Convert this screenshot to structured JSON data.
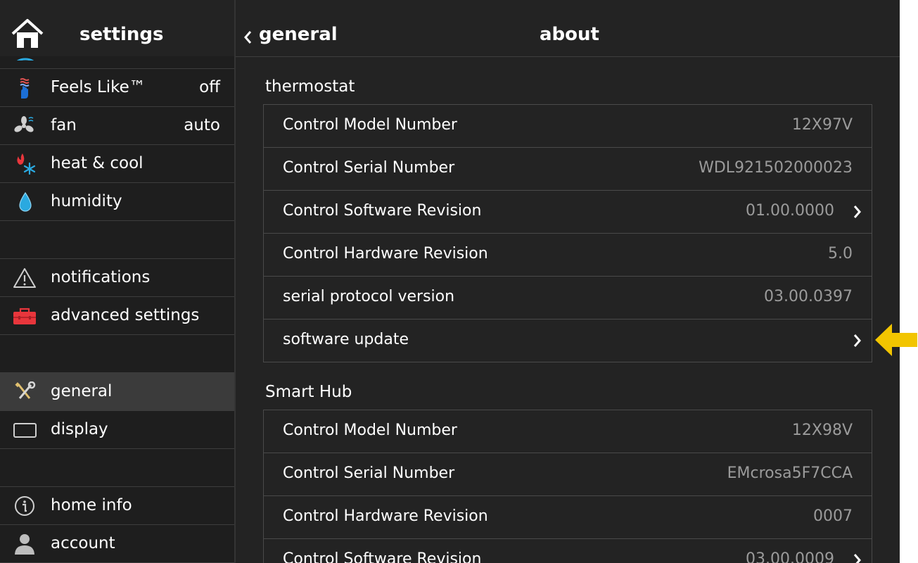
{
  "sidebar": {
    "title": "settings",
    "items": [
      {
        "label": "Feels Like™",
        "value": "off",
        "icon": "hand-waves-icon"
      },
      {
        "label": "fan",
        "value": "auto",
        "icon": "fan-icon"
      },
      {
        "label": "heat & cool",
        "value": "",
        "icon": "flame-snowflake-icon"
      },
      {
        "label": "humidity",
        "value": "",
        "icon": "droplet-icon"
      },
      {
        "label": "notifications",
        "value": "",
        "icon": "warning-triangle-icon"
      },
      {
        "label": "advanced settings",
        "value": "",
        "icon": "toolbox-icon"
      },
      {
        "label": "general",
        "value": "",
        "icon": "wrench-screwdriver-icon",
        "selected": true
      },
      {
        "label": "display",
        "value": "",
        "icon": "display-icon"
      },
      {
        "label": "home info",
        "value": "",
        "icon": "info-icon"
      },
      {
        "label": "account",
        "value": "",
        "icon": "person-icon"
      }
    ]
  },
  "header": {
    "back_label": "general",
    "title": "about"
  },
  "sections": [
    {
      "title": "thermostat",
      "rows": [
        {
          "label": "Control Model Number",
          "value": "12X97V"
        },
        {
          "label": "Control Serial Number",
          "value": "WDL921502000023"
        },
        {
          "label": "Control Software Revision",
          "value": "01.00.0000",
          "link": true
        },
        {
          "label": "Control Hardware Revision",
          "value": "5.0"
        },
        {
          "label": "serial protocol version",
          "value": "03.00.0397"
        },
        {
          "label": "software update",
          "value": "",
          "link": true
        }
      ]
    },
    {
      "title": "Smart Hub",
      "rows": [
        {
          "label": "Control Model Number",
          "value": "12X98V"
        },
        {
          "label": "Control Serial Number",
          "value": "EMcrosa5F7CCA"
        },
        {
          "label": "Control Hardware Revision",
          "value": "0007"
        },
        {
          "label": "Control Software Revision",
          "value": "03.00.0009",
          "link": true
        }
      ]
    }
  ],
  "colors": {
    "background": "#232323",
    "sidebar": "#1e1e1e",
    "selected": "#3b3b3b",
    "value_text": "#9b9b9b",
    "arrow": "#f2c500"
  }
}
